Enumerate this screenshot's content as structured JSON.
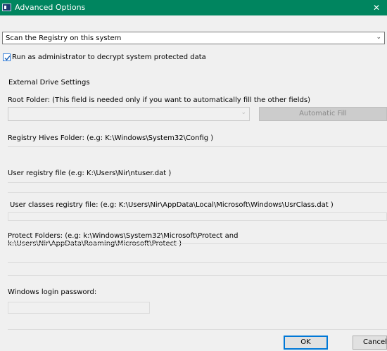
{
  "window": {
    "title": "Advanced Options",
    "close_glyph": "✕"
  },
  "source": {
    "selected": "Scan the Registry on this system"
  },
  "run_as_admin": {
    "checked": true,
    "label": "Run as administrator to decrypt system protected data"
  },
  "external": {
    "heading": "External Drive Settings",
    "root_folder_label": "Root Folder: (This field is needed only if you want to automatically fill the other fields)",
    "root_folder_value": "",
    "automatic_fill_label": "Automatic Fill",
    "hives_label": "Registry Hives Folder: (e.g: K:\\Windows\\System32\\Config )",
    "user_file_label": "User registry file (e.g: K:\\Users\\Nir\\ntuser.dat )",
    "user_classes_label": "User classes registry file: (e.g: K:\\Users\\Nir\\AppData\\Local\\Microsoft\\Windows\\UsrClass.dat )",
    "protect_label": "Protect Folders: (e.g: k:\\Windows\\System32\\Microsoft\\Protect and k:\\Users\\Nir\\AppData\\Roaming\\Microsoft\\Protect )",
    "password_label": "Windows login password:"
  },
  "buttons": {
    "ok": "OK",
    "cancel": "Cancel"
  }
}
